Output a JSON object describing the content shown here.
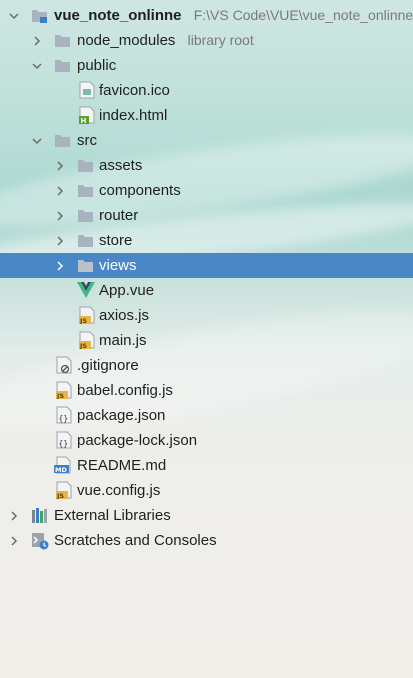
{
  "tree": {
    "root": {
      "name": "vue_note_onlinne",
      "path": "F:\\VS Code\\VUE\\vue_note_onlinne"
    },
    "node_modules": {
      "name": "node_modules",
      "hint": "library root"
    },
    "public": {
      "name": "public",
      "children": [
        "favicon.ico",
        "index.html"
      ]
    },
    "src": {
      "name": "src",
      "folders": [
        "assets",
        "components",
        "router",
        "store",
        "views"
      ],
      "files": [
        "App.vue",
        "axios.js",
        "main.js"
      ]
    },
    "root_files": [
      ".gitignore",
      "babel.config.js",
      "package.json",
      "package-lock.json",
      "README.md",
      "vue.config.js"
    ],
    "external_libraries": "External Libraries",
    "scratches": "Scratches and Consoles",
    "selected": "views"
  },
  "colors": {
    "selection": "#4a87c7",
    "folder": "#a9b3bd",
    "js_badge": "#e8b54a",
    "vue_green": "#41b883",
    "vue_dark": "#35495e",
    "md_badge": "#3d7fc4"
  },
  "icons": {
    "chevron": "chevron-icon",
    "folder": "folder-icon",
    "js": "js-file-icon",
    "json": "json-file-icon",
    "vue": "vue-file-icon",
    "html": "html-file-icon",
    "ico": "image-file-icon",
    "md": "markdown-file-icon",
    "ignore": "gitignore-file-icon",
    "libraries": "libraries-icon",
    "scratches": "scratches-icon"
  }
}
